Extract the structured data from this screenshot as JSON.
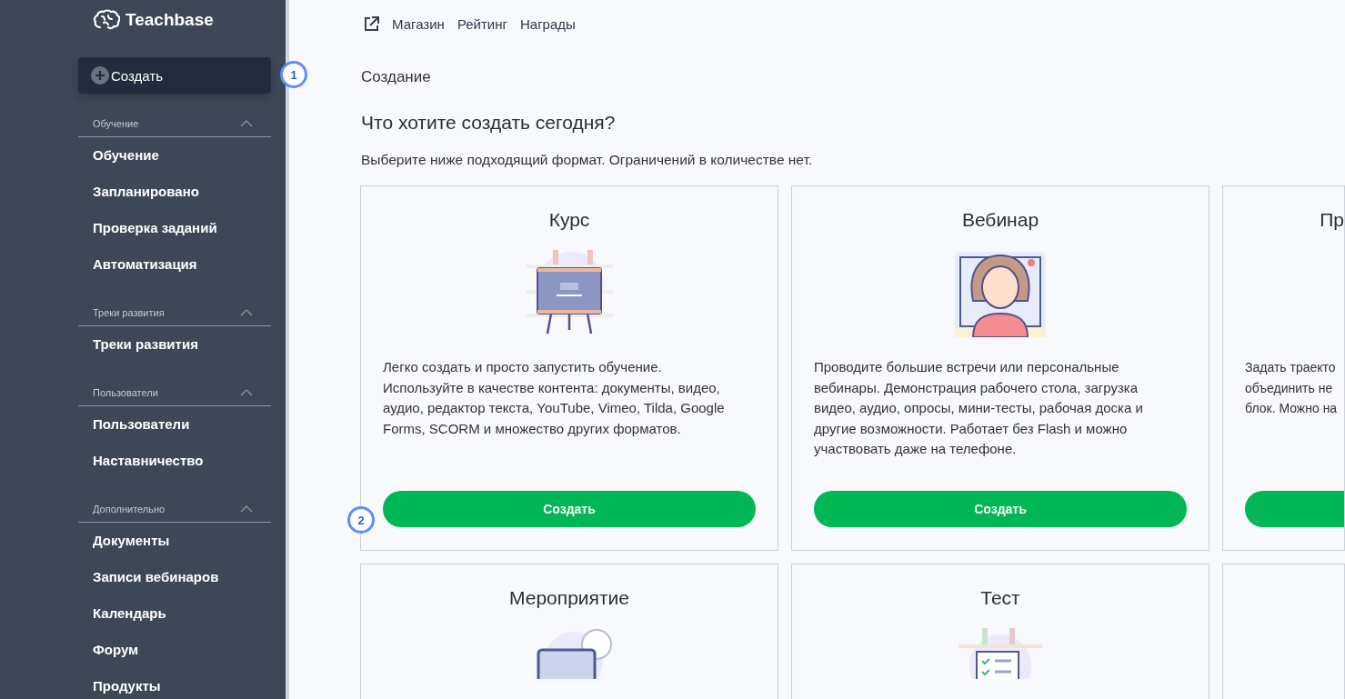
{
  "sidebar": {
    "logo": "Teachbase",
    "create_button": "Создать",
    "sections": [
      {
        "title": "Обучение",
        "expanded": true,
        "items": [
          "Обучение",
          "Запланировано",
          "Проверка заданий",
          "Автоматизация"
        ]
      },
      {
        "title": "Треки развития",
        "expanded": true,
        "items": [
          "Треки развития"
        ]
      },
      {
        "title": "Пользователи",
        "expanded": true,
        "items": [
          "Пользователи",
          "Наставничество"
        ]
      },
      {
        "title": "Дополнительно",
        "expanded": true,
        "items": [
          "Документы",
          "Записи вебинаров",
          "Календарь",
          "Форум",
          "Продукты"
        ]
      }
    ]
  },
  "topnav": [
    "Магазин",
    "Рейтинг",
    "Награды"
  ],
  "breadcrumb": "Создание",
  "heading": "Что хотите создать сегодня?",
  "subheading": "Выберите ниже подходящий формат. Ограничений в количестве нет.",
  "cards": [
    {
      "kind": "course",
      "title": "Курс",
      "description": "Легко создать и просто запустить обучение. Используйте в качестве контента: документы, видео, аудио, редактор текста, YouTube, Vimeo, Tilda, Google Forms, SCORM и множество других форматов.",
      "button": "Создать"
    },
    {
      "kind": "webinar",
      "title": "Вебинар",
      "description": "Проводите большие встречи или персональные вебинары. Демонстрация рабочего стола, загрузка видео, аудио, опросы, мини-тесты, рабочая доска и другие возможности. Работает без Flash и можно участвовать даже на телефоне.",
      "button": "Создать"
    },
    {
      "kind": "partial",
      "title": "Пр",
      "lines": [
        "Задать траекто",
        "объединить не",
        "блок. Можно на"
      ]
    },
    {
      "kind": "event",
      "title": "Мероприятие"
    },
    {
      "kind": "test",
      "title": "Тест"
    },
    {
      "kind": "empty"
    }
  ],
  "markers": [
    "1",
    "2"
  ]
}
